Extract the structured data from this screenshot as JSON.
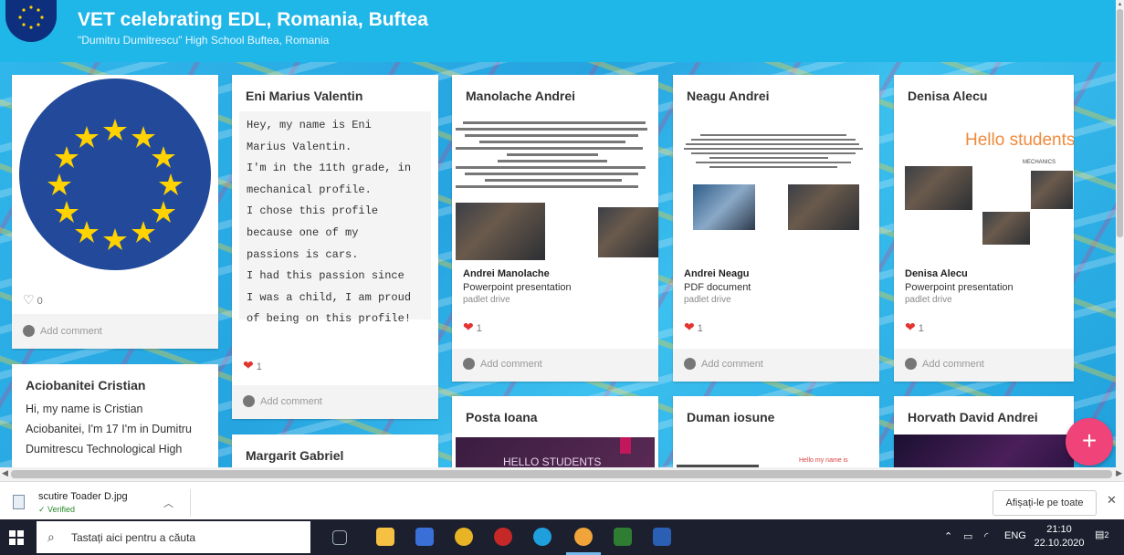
{
  "header": {
    "title": "VET celebrating EDL, Romania, Buftea",
    "subtitle": "\"Dumitru Dumitrescu\" High School Buftea, Romania"
  },
  "cards": {
    "eu_flag": {
      "like_count": "0",
      "add_comment": "Add comment"
    },
    "eni": {
      "name": "Eni Marius Valentin",
      "lines": [
        "Hey, my name is Eni",
        "Marius Valentin.",
        "I'm in the 11th grade, in",
        "mechanical profile.",
        "I chose this profile",
        "because one of my",
        "passions is cars.",
        "I had this passion since",
        "I was a child, I am proud",
        "of being on this profile!"
      ],
      "like_count": "1",
      "add_comment": "Add comment"
    },
    "aciobanitei": {
      "name": "Aciobanitei Cristian",
      "lines": [
        "Hi, my name is Cristian",
        "Aciobanitei, I'm 17 I'm in Dumitru",
        "Dumitrescu Technological High"
      ]
    },
    "margarit": {
      "name": "Margarit Gabriel"
    },
    "manolache": {
      "name": "Manolache Andrei",
      "attachment_title": "Andrei Manolache",
      "attachment_type": "Powerpoint presentation",
      "attachment_source": "padlet drive",
      "like_count": "1",
      "add_comment": "Add comment"
    },
    "neagu": {
      "name": "Neagu Andrei",
      "attachment_title": "Andrei Neagu",
      "attachment_type": "PDF document",
      "attachment_source": "padlet drive",
      "like_count": "1",
      "add_comment": "Add comment"
    },
    "denisa": {
      "name": "Denisa Alecu",
      "thumb_heading": "Hello students",
      "thumb_caption": "MECHANICS",
      "attachment_title": "Denisa Alecu",
      "attachment_type": "Powerpoint presentation",
      "attachment_source": "padlet drive",
      "like_count": "1",
      "add_comment": "Add comment"
    },
    "posta": {
      "name": "Posta Ioana",
      "thumb_text": "HELLO STUDENTS"
    },
    "duman": {
      "name": "Duman iosune",
      "thumb_text": "Hello my name is"
    },
    "horvath": {
      "name": "Horvath David Andrei"
    }
  },
  "fab": {
    "label": "+"
  },
  "download_bar": {
    "file_name": "scutire Toader D.jpg",
    "status": "✓ Verified",
    "show_all": "Afișați-le pe toate",
    "close": "✕"
  },
  "taskbar": {
    "search_placeholder": "Tastați aici pentru a căuta",
    "language": "ENG",
    "time": "21:10",
    "date": "22.10.2020",
    "notification_count": "2"
  },
  "colors": {
    "header_bg": "#1fb6e8",
    "like_heart": "#e3342f",
    "fab": "#f0437a",
    "denisa_heading": "#f08a3c"
  }
}
